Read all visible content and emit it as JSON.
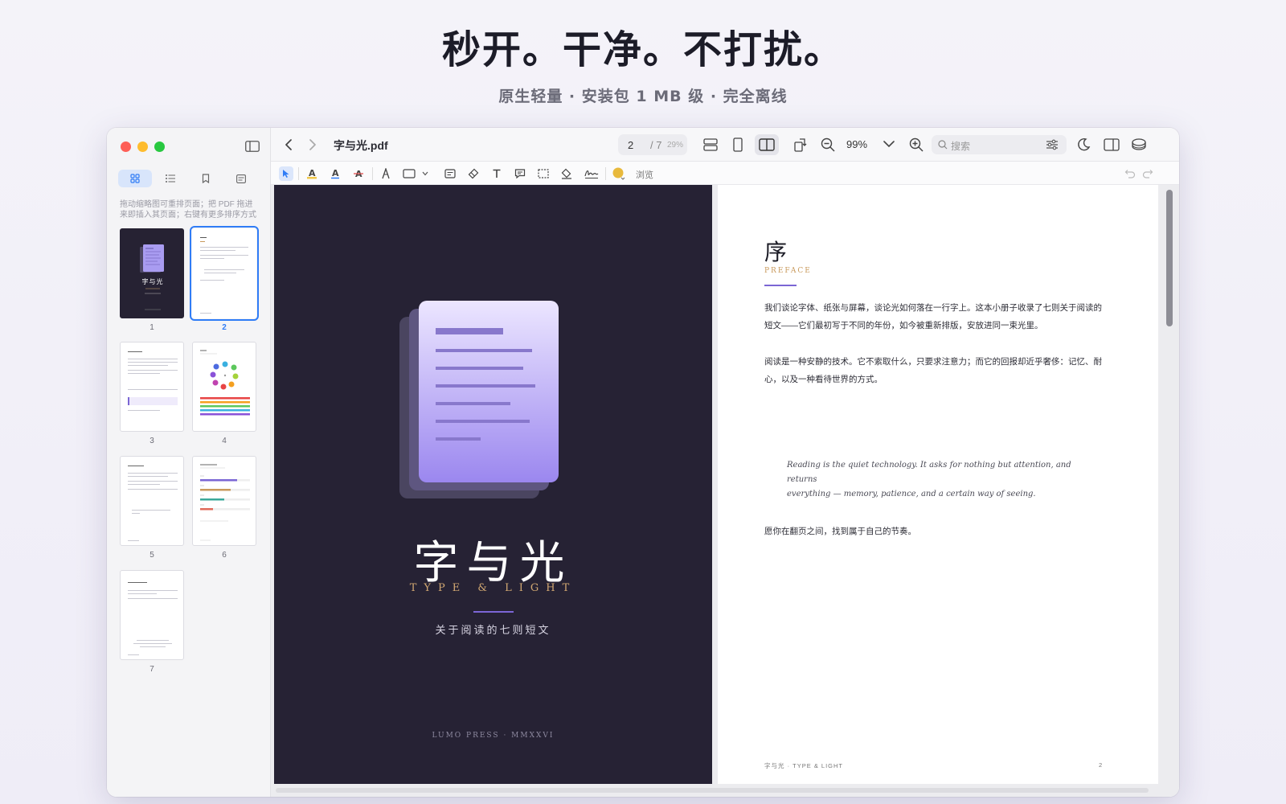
{
  "hero": {
    "title": "秒开。干净。不打扰。",
    "subtitle": "原生轻量 · 安装包 1 MB 级 · 完全离线"
  },
  "sidebar": {
    "hint": "拖动缩略图可重排页面；把 PDF 拖进来即插入其页面；右键有更多排序方式",
    "tabs": [
      {
        "icon": "grid-icon",
        "active": true
      },
      {
        "icon": "list-icon",
        "active": false
      },
      {
        "icon": "bookmark-icon",
        "active": false
      },
      {
        "icon": "notes-icon",
        "active": false
      }
    ],
    "thumbnails": [
      {
        "num": "1",
        "title": "字与光"
      },
      {
        "num": "2"
      },
      {
        "num": "3"
      },
      {
        "num": "4"
      },
      {
        "num": "5"
      },
      {
        "num": "6"
      },
      {
        "num": "7"
      }
    ],
    "selected_page": "2"
  },
  "toolbar": {
    "doc_title": "字与光.pdf",
    "page_current": "2",
    "page_total": "/ 7",
    "page_percent": "29%",
    "zoom": "99%",
    "search_placeholder": "搜索"
  },
  "annotbar": {
    "browse_label": "浏览",
    "active_tool": "select-tool",
    "color": "#e8b93c"
  },
  "cover": {
    "title": "字与光",
    "title_en": "TYPE & LIGHT",
    "subtitle": "关于阅读的七则短文",
    "press": "LUMO PRESS · MMXXVI"
  },
  "page2": {
    "heading": "序",
    "heading_en": "PREFACE",
    "para1_line1": "我们谈论字体、纸张与屏幕，谈论光如何落在一行字上。这本小册子收录了七则关于阅读的",
    "para1_line2": "短文——它们最初写于不同的年份，如今被重新排版，安放进同一束光里。",
    "para2_line1": "阅读是一种安静的技术。它不索取什么，只要求注意力；而它的回报却近乎奢侈：记忆、耐",
    "para2_line2": "心，以及一种看待世界的方式。",
    "quote_line1": "Reading is the quiet technology. It asks for nothing but attention, and returns",
    "quote_line2": "everything — memory, patience, and a certain way of seeing.",
    "closing": "愿你在翻页之间，找到属于自己的节奏。",
    "footer": "字与光 · TYPE & LIGHT",
    "page_number": "2"
  },
  "colors": {
    "accent": "#2f7cf6",
    "cover_bg": "#262234",
    "gold": "#c99a5c",
    "purple": "#7b66d4"
  }
}
